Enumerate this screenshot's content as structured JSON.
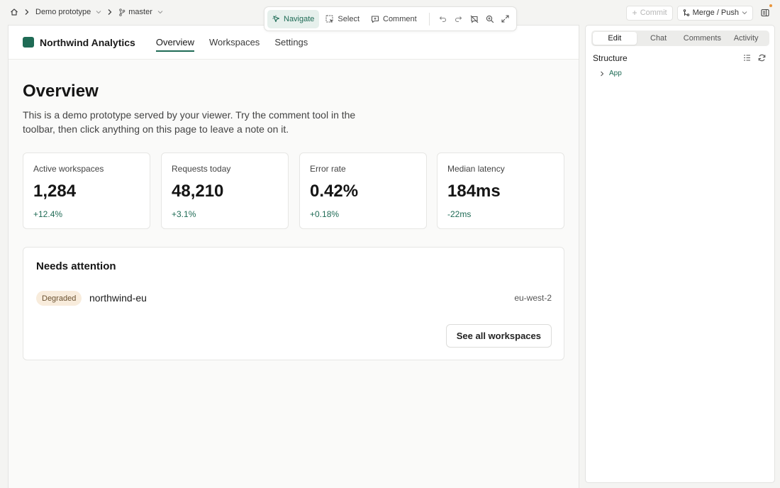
{
  "topbar": {
    "project": "Demo prototype",
    "branch": "master",
    "tools": {
      "navigate": "Navigate",
      "select": "Select",
      "comment": "Comment"
    },
    "commit_label": "Commit",
    "merge_label": "Merge / Push"
  },
  "app": {
    "brand": "Northwind Analytics",
    "nav": [
      "Overview",
      "Workspaces",
      "Settings"
    ],
    "active_nav": "Overview"
  },
  "page": {
    "title": "Overview",
    "description": "This is a demo prototype served by your viewer. Try the comment tool in the toolbar, then click anything on this page to leave a note on it."
  },
  "stats": [
    {
      "label": "Active workspaces",
      "value": "1,284",
      "delta": "+12.4%"
    },
    {
      "label": "Requests today",
      "value": "48,210",
      "delta": "+3.1%"
    },
    {
      "label": "Error rate",
      "value": "0.42%",
      "delta": "+0.18%"
    },
    {
      "label": "Median latency",
      "value": "184ms",
      "delta": "-22ms"
    }
  ],
  "attention": {
    "title": "Needs attention",
    "item": {
      "status": "Degraded",
      "name": "northwind-eu",
      "region": "eu-west-2"
    },
    "button": "See all workspaces"
  },
  "panel": {
    "tabs": [
      "Edit",
      "Chat",
      "Comments",
      "Activity"
    ],
    "active_tab": "Edit",
    "structure_title": "Structure",
    "tree": [
      {
        "label": "App"
      }
    ]
  },
  "colors": {
    "accent": "#1f6b55",
    "badge_bg": "#f8ecdc",
    "badge_text": "#6b5231",
    "notification": "#e8943a"
  }
}
